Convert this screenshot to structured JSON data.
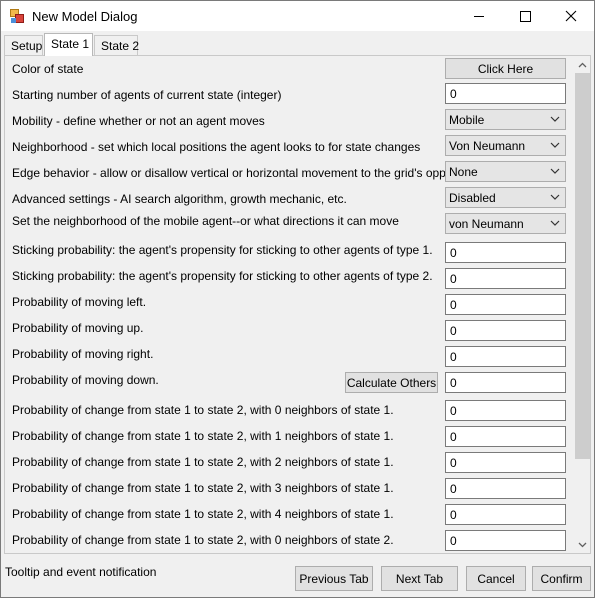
{
  "window": {
    "title": "New Model Dialog"
  },
  "tabs": [
    {
      "label": "Setup"
    },
    {
      "label": "State 1"
    },
    {
      "label": "State 2"
    }
  ],
  "rows": {
    "color": {
      "label": "Color of state",
      "button": "Click Here"
    },
    "starting": {
      "label": "Starting number of agents of current state (integer)",
      "value": "0"
    },
    "mobility": {
      "label": "Mobility - define whether or not an agent moves",
      "value": "Mobile"
    },
    "neighborhood": {
      "label": "Neighborhood - set which local positions the agent looks to for state changes",
      "value": "Von Neumann"
    },
    "edge": {
      "label": "Edge behavior - allow or disallow vertical or horizontal movement to the grid's opposite side",
      "value": "None"
    },
    "advanced": {
      "label": "Advanced settings - AI search algorithm, growth mechanic, etc.",
      "value": "Disabled"
    },
    "mobile_neighborhood": {
      "label": "Set the neighborhood of the mobile agent--or what directions it can move",
      "value": "von Neumann"
    },
    "stick1": {
      "label": "Sticking probability: the agent's propensity for sticking to other agents of type 1.",
      "value": "0"
    },
    "stick2": {
      "label": "Sticking probability: the agent's propensity for sticking to other agents of type 2.",
      "value": "0"
    },
    "left": {
      "label": "Probability of moving left.",
      "value": "0"
    },
    "up": {
      "label": "Probability of moving up.",
      "value": "0"
    },
    "right": {
      "label": "Probability of moving right.",
      "value": "0"
    },
    "down": {
      "label": "Probability of moving down.",
      "value": "0",
      "button": "Calculate Others"
    },
    "change0": {
      "label": "Probability of change from state 1 to state 2, with 0 neighbors of state 1.",
      "value": "0"
    },
    "change1": {
      "label": "Probability of change from state 1 to state 2, with 1 neighbors of state 1.",
      "value": "0"
    },
    "change2": {
      "label": "Probability of change from state 1 to state 2, with 2 neighbors of state 1.",
      "value": "0"
    },
    "change3": {
      "label": "Probability of change from state 1 to state 2, with 3 neighbors of state 1.",
      "value": "0"
    },
    "change4": {
      "label": "Probability of change from state 1 to state 2, with 4 neighbors of state 1.",
      "value": "0"
    },
    "change5": {
      "label": "Probability of change from state 1 to state 2, with 0 neighbors of state 2.",
      "value": "0"
    }
  },
  "status": {
    "text": "Tooltip and event notification"
  },
  "buttons": {
    "previous": "Previous Tab",
    "next": "Next Tab",
    "cancel": "Cancel",
    "confirm": "Confirm"
  }
}
